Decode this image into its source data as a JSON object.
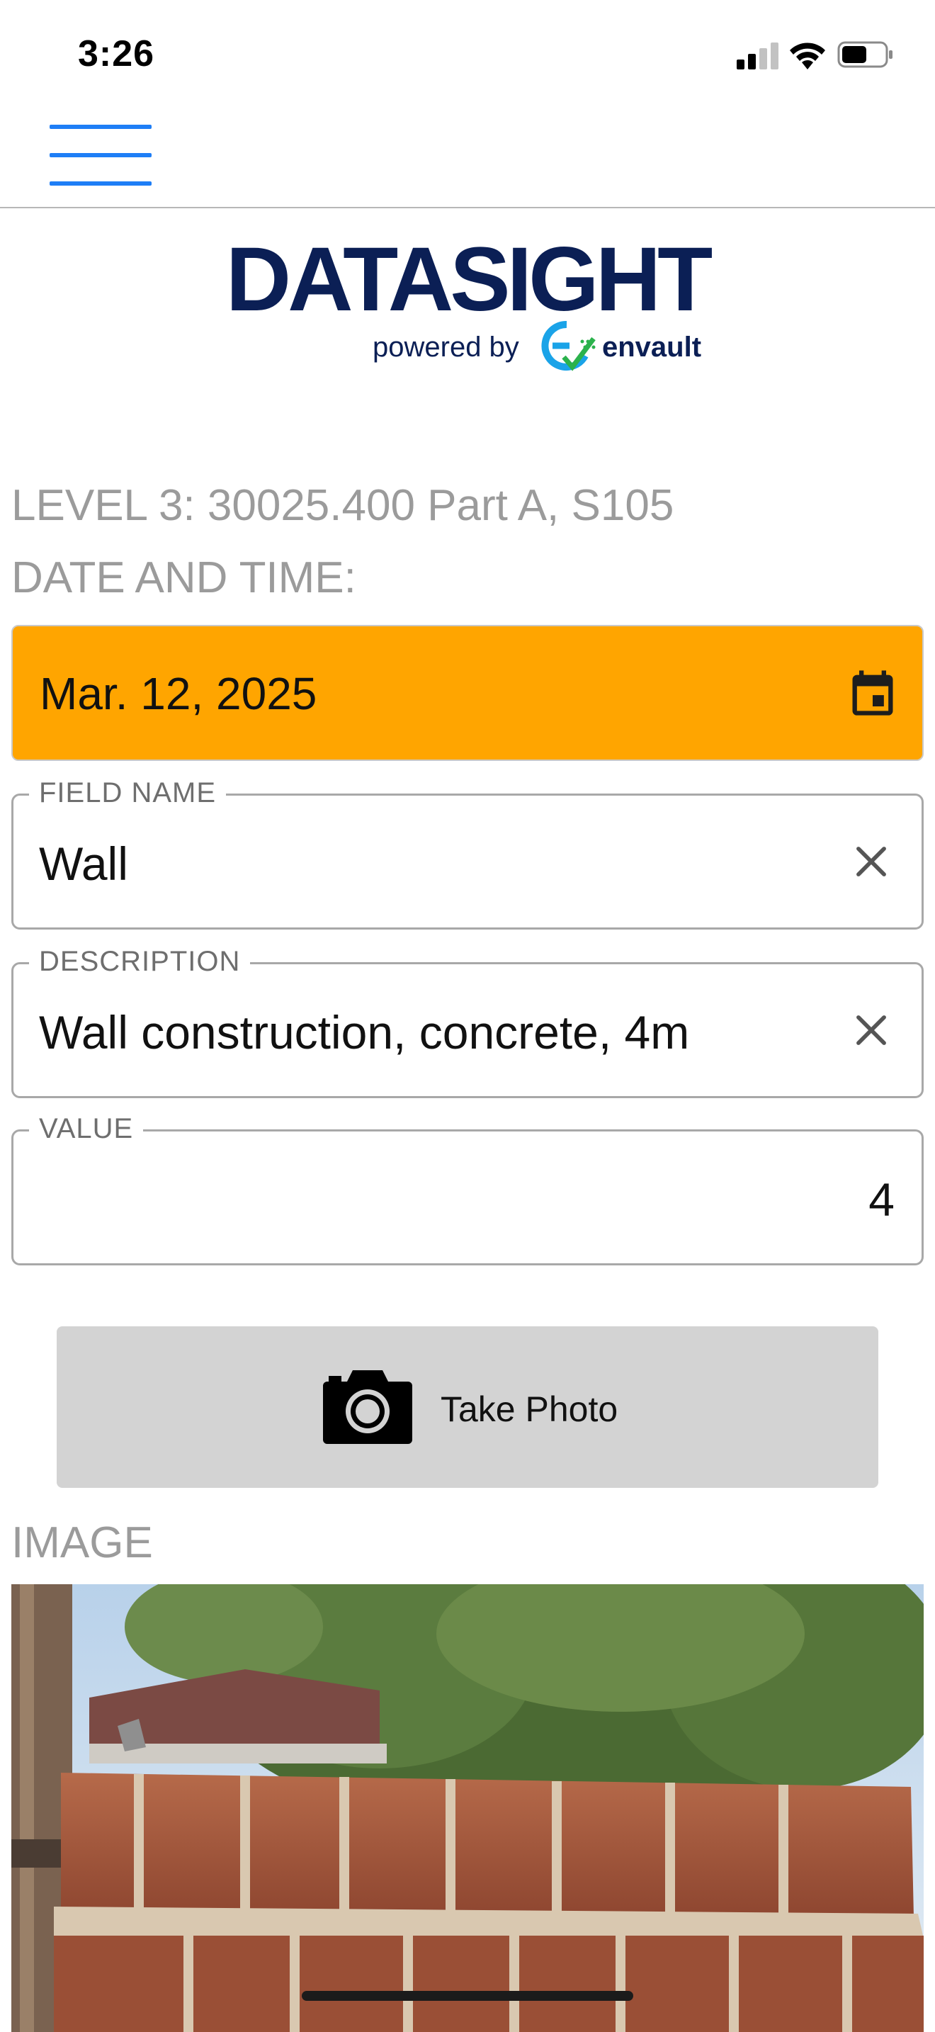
{
  "status_bar": {
    "time": "3:26",
    "signal_icon": "cellular-signal-icon",
    "wifi_icon": "wifi-icon",
    "battery_icon": "battery-icon"
  },
  "header": {
    "menu_icon": "hamburger-menu-icon"
  },
  "logo": {
    "title": "DATASIGHT",
    "powered_by": "powered by",
    "brand": "envault",
    "brand_mark": "envault-logo-mark"
  },
  "form": {
    "level_label": "LEVEL 3: 30025.400 Part A, S105",
    "datetime_label": "DATE AND TIME:",
    "date_value": "Mar. 12, 2025",
    "date_icon": "calendar-icon",
    "date_background": "#FFA500",
    "field_name": {
      "label": "FIELD NAME",
      "value": "Wall",
      "clear_icon": "close-icon"
    },
    "description": {
      "label": "DESCRIPTION",
      "value": "Wall construction, concrete, 4m",
      "clear_icon": "close-icon"
    },
    "value_field": {
      "label": "VALUE",
      "value": "4"
    },
    "take_photo": {
      "label": "Take Photo",
      "icon": "camera-icon"
    },
    "image_label": "IMAGE"
  },
  "colors": {
    "accent": "#1E7EF6",
    "brand_navy": "#0B1F55",
    "date_field": "#FFA500",
    "label_gray": "#9B9B9B",
    "button_gray": "#D3D3D3"
  }
}
